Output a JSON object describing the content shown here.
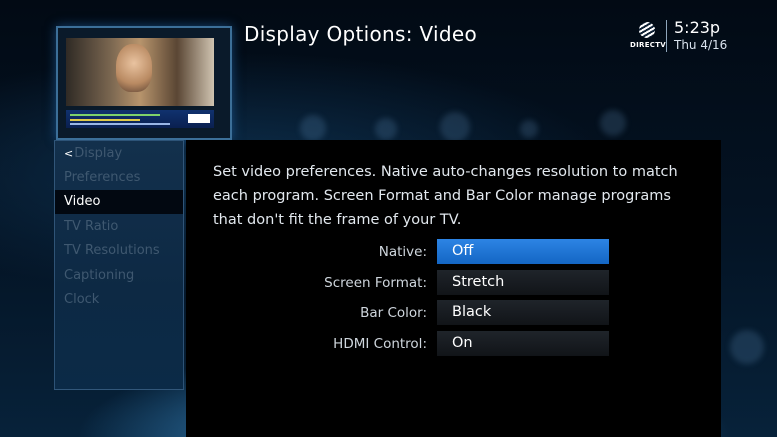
{
  "header": {
    "title": "Display Options: Video",
    "brand": "DIRECTV",
    "time": "5:23p",
    "date": "Thu 4/16"
  },
  "sidebar": {
    "back_label": "Display",
    "items": [
      {
        "label": "Preferences",
        "state": "inactive"
      },
      {
        "label": "Video",
        "state": "active"
      },
      {
        "label": "TV Ratio",
        "state": "inactive"
      },
      {
        "label": "TV Resolutions",
        "state": "inactive"
      },
      {
        "label": "Captioning",
        "state": "inactive"
      },
      {
        "label": "Clock",
        "state": "inactive"
      }
    ]
  },
  "main": {
    "description": "Set video preferences. Native auto-changes resolution to match each program. Screen Format and Bar Color manage programs that don't fit the frame of your TV.",
    "options": [
      {
        "label": "Native:",
        "value": "Off",
        "selected": true
      },
      {
        "label": "Screen Format:",
        "value": "Stretch",
        "selected": false
      },
      {
        "label": "Bar Color:",
        "value": "Black",
        "selected": false
      },
      {
        "label": "HDMI Control:",
        "value": "On",
        "selected": false
      }
    ]
  },
  "colors": {
    "selection": "#1f77d8",
    "panel": "#000000",
    "sidebar": "#102c48"
  }
}
